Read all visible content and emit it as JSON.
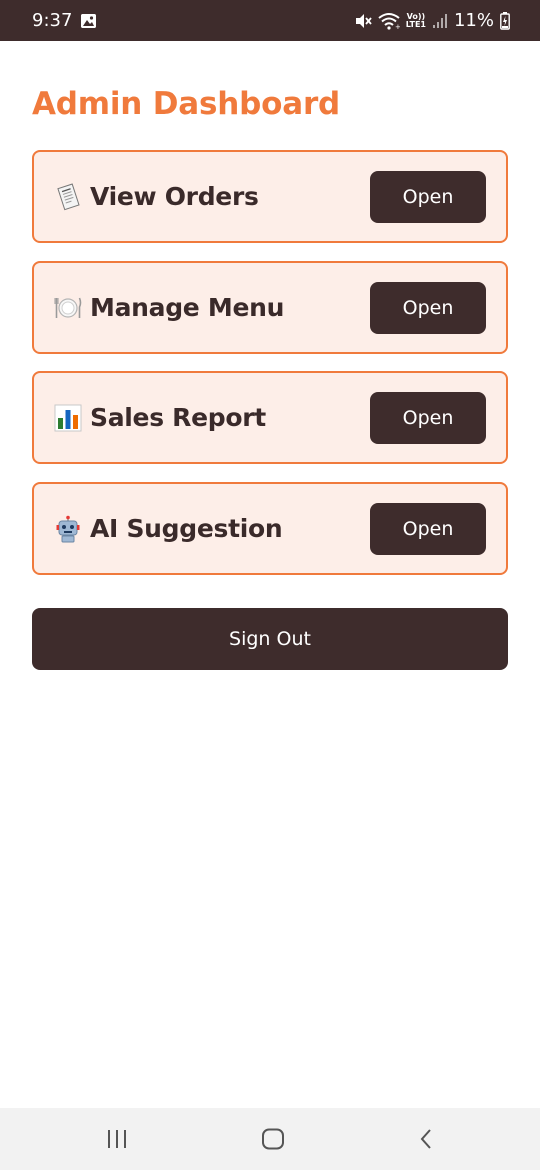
{
  "status_bar": {
    "time": "9:37",
    "volte_top": "Vo))",
    "volte_bottom": "LTE1",
    "battery": "11%",
    "icons": [
      "image-notification-icon",
      "mute-icon",
      "wifi-icon",
      "volte-icon",
      "signal-icon",
      "battery-charging-icon"
    ]
  },
  "page": {
    "title": "Admin Dashboard"
  },
  "cards": [
    {
      "icon": "receipt-icon",
      "label": "View Orders",
      "button": "Open"
    },
    {
      "icon": "plate-cutlery-icon",
      "label": "Manage Menu",
      "button": "Open"
    },
    {
      "icon": "bar-chart-icon",
      "label": "Sales Report",
      "button": "Open"
    },
    {
      "icon": "robot-icon",
      "label": "AI Suggestion",
      "button": "Open"
    }
  ],
  "sign_out": {
    "label": "Sign Out"
  },
  "nav_bar": {
    "icons": [
      "recent-apps-icon",
      "home-icon",
      "back-icon"
    ]
  },
  "colors": {
    "accent": "#f07a3c",
    "dark": "#3e2c2c",
    "card_bg": "#fdeee8",
    "text": "#3a2a2a"
  }
}
